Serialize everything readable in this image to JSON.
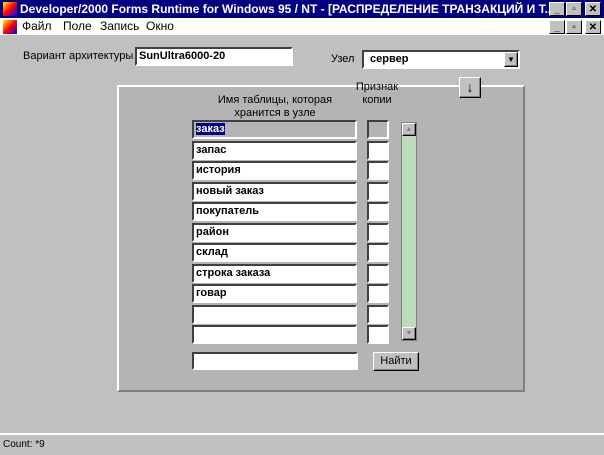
{
  "window": {
    "title": "Developer/2000 Forms Runtime for Windows 95 / NT - [РАСПРЕДЕЛЕНИЕ  ТРАНЗАКЦИЙ  И  Т...",
    "min": "_",
    "max": "▫",
    "close": "✕"
  },
  "menu": [
    "Файл",
    "Поле",
    "Запись",
    "Окно"
  ],
  "form": {
    "arch_label": "Вариант архитектуры",
    "arch_value": "SunUltra6000-20",
    "node_label": "Узел",
    "node_value": "сервер",
    "col_name_header": "Имя таблицы, которая хранится в узле",
    "col_copy_header": "Признак копии",
    "rows": [
      "заказ",
      "запас",
      "история",
      "новый заказ",
      "покупатель",
      "район",
      "склад",
      "строка заказа",
      "говар",
      "",
      ""
    ],
    "search_value": "",
    "find_button": "Найти",
    "down_button": "↓"
  },
  "status": {
    "text": "Count: *9"
  }
}
